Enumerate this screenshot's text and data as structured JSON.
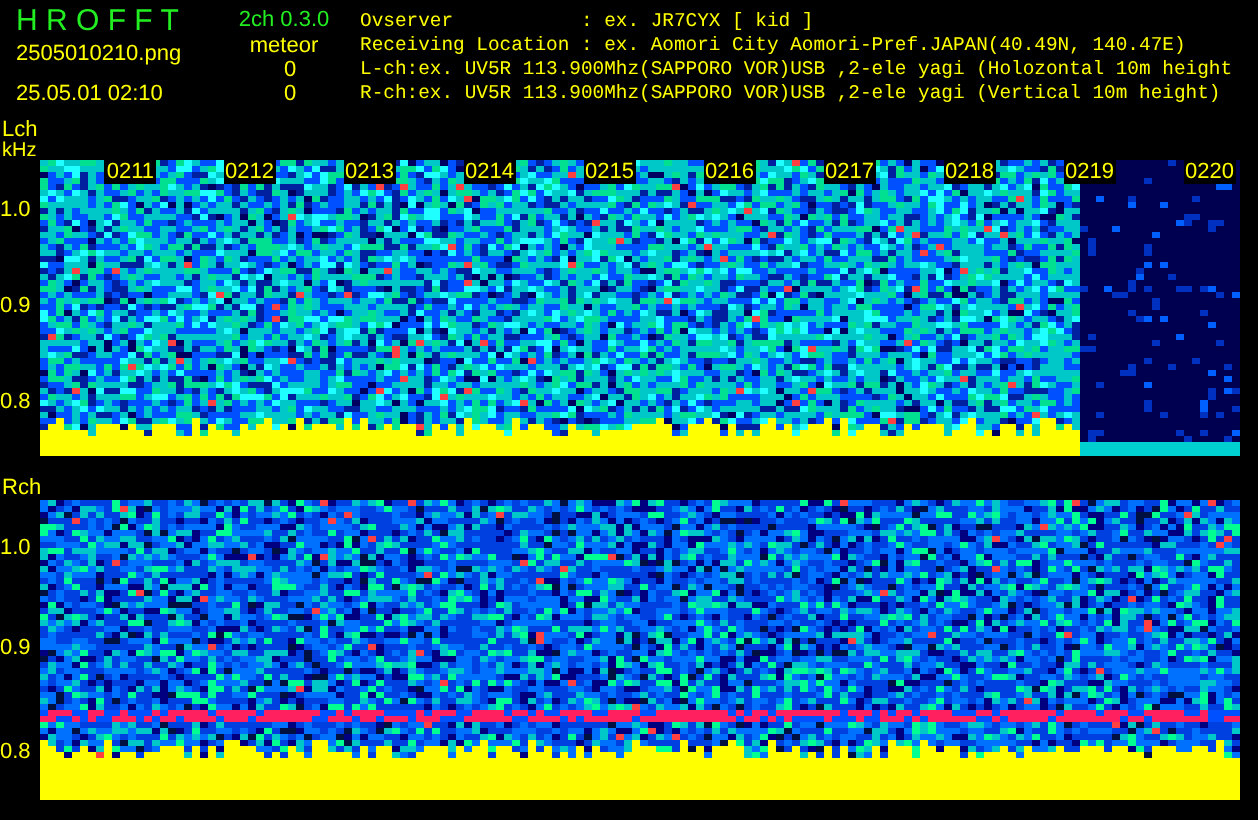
{
  "app": {
    "title": "H R O F F T",
    "version": "2ch 0.3.0",
    "filename": "2505010210.png",
    "timestamp": "25.05.01 02:10"
  },
  "meteor": {
    "label": "meteor",
    "counts": [
      "0",
      "0"
    ]
  },
  "info_lines": [
    "Ovserver           : ex. JR7CYX [ kid ]",
    "Receiving Location : ex. Aomori City Aomori-Pref.JAPAN(40.49N, 140.47E)",
    "L-ch:ex. UV5R 113.900Mhz(SAPPORO VOR)USB ,2-ele yagi (Holozontal 10m height",
    "R-ch:ex. UV5R 113.900Mhz(SAPPORO VOR)USB ,2-ele yagi (Vertical 10m height)"
  ],
  "channels": [
    {
      "label": "Lch",
      "unit": "kHz",
      "yticks": [
        "1.0",
        "0.9",
        "0.8"
      ],
      "time_labels": [
        "0211",
        "0212",
        "0213",
        "0214",
        "0215",
        "0216",
        "0217",
        "0218",
        "0219",
        "0220"
      ]
    },
    {
      "label": "Rch",
      "yticks": [
        "1.0",
        "0.9",
        "0.8"
      ]
    }
  ]
}
